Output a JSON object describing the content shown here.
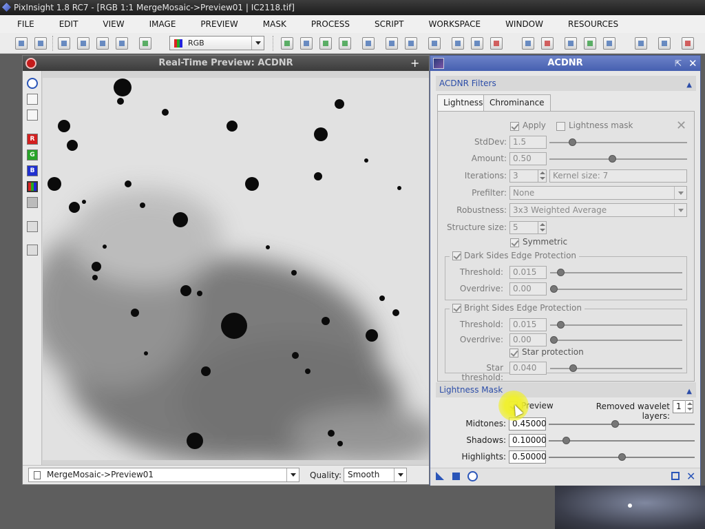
{
  "titlebar": {
    "text": "PixInsight 1.8 RC7 - [RGB 1:1 MergeMosaic->Preview01 | IC2118.tif]"
  },
  "menu": [
    "FILE",
    "EDIT",
    "VIEW",
    "IMAGE",
    "PREVIEW",
    "MASK",
    "PROCESS",
    "SCRIPT",
    "WORKSPACE",
    "WINDOW",
    "RESOURCES"
  ],
  "toolbar": {
    "view_mode": "RGB"
  },
  "preview_window": {
    "title": "Real-Time Preview: ACDNR",
    "plus": "+",
    "view_selector": "MergeMosaic->Preview01",
    "quality_label": "Quality:",
    "quality_value": "Smooth",
    "channel_buttons": [
      "R",
      "G",
      "B"
    ]
  },
  "acdnr": {
    "title": "ACDNR",
    "filters_header": "ACDNR Filters",
    "tabs": [
      "Lightness",
      "Chrominance"
    ],
    "apply_label": "Apply",
    "lightness_mask_label": "Lightness mask",
    "stddev_label": "StdDev:",
    "stddev_value": "1.5",
    "amount_label": "Amount:",
    "amount_value": "0.50",
    "iterations_label": "Iterations:",
    "iterations_value": "3",
    "kernel_size_text": "Kernel size: 7",
    "prefilter_label": "Prefilter:",
    "prefilter_value": "None",
    "robustness_label": "Robustness:",
    "robustness_value": "3x3 Weighted Average",
    "structure_label": "Structure size:",
    "structure_value": "5",
    "symmetric_label": "Symmetric",
    "dark_group": "Dark Sides Edge Protection",
    "dark_threshold_label": "Threshold:",
    "dark_threshold_value": "0.015",
    "dark_overdrive_label": "Overdrive:",
    "dark_overdrive_value": "0.00",
    "bright_group": "Bright Sides Edge Protection",
    "bright_threshold_label": "Threshold:",
    "bright_threshold_value": "0.015",
    "bright_overdrive_label": "Overdrive:",
    "bright_overdrive_value": "0.00",
    "star_protection_label": "Star protection",
    "star_threshold_label": "Star threshold:",
    "star_threshold_value": "0.040",
    "mask_header": "Lightness Mask",
    "preview_label": "Preview",
    "removed_layers_label": "Removed wavelet layers:",
    "removed_layers_value": "1",
    "midtones_label": "Midtones:",
    "midtones_value": "0.45000",
    "shadows_label": "Shadows:",
    "shadows_value": "0.10000",
    "highlights_label": "Highlights:",
    "highlights_value": "0.50000"
  },
  "colors": {
    "accent": "#4660b0",
    "section_text": "#2c4da8",
    "close_red": "#c41a1a"
  }
}
